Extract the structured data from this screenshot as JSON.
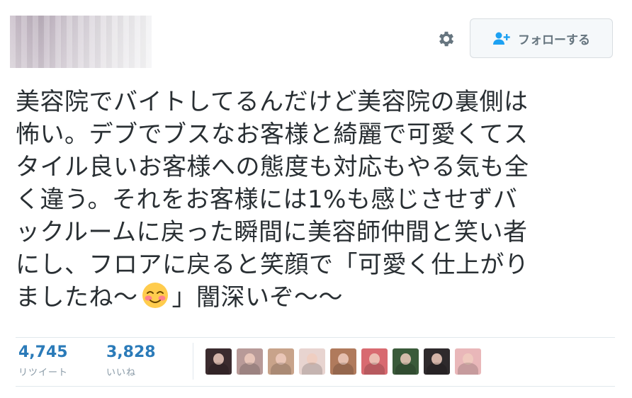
{
  "header": {
    "follow_label": "フォローする"
  },
  "tweet": {
    "lines": [
      "美容院でバイトしてるんだけど美容院の裏側は",
      "怖い。デブでブスなお客様と綺麗で可愛くてス",
      "タイル良いお客様への態度も対応もやる気も全",
      "く違う。それをお客様には1%も感じさせずバ",
      "ックルームに戻った瞬間に美容師仲間と笑い者",
      "にし、フロアに戻ると笑顔で「可愛く仕上がり"
    ],
    "last_line_before_emoji": "ましたね〜",
    "emoji": "smiling-face-with-blush",
    "last_line_after_emoji": "」闇深いぞ〜〜"
  },
  "stats": {
    "retweets": {
      "count": "4,745",
      "label": "リツイート"
    },
    "likes": {
      "count": "3,828",
      "label": "いいね"
    }
  },
  "colors": {
    "link_blue": "#2b7bb9",
    "muted": "#8899a6",
    "follow_icon": "#1da1f2"
  },
  "liker_avatars": [
    {
      "bg": "#3b2b2e"
    },
    {
      "bg": "#b89a98"
    },
    {
      "bg": "#c8a38a"
    },
    {
      "bg": "#e8d4d0"
    },
    {
      "bg": "#b07a5c"
    },
    {
      "bg": "#d86a70"
    },
    {
      "bg": "#3a5a3a"
    },
    {
      "bg": "#2e2a2c"
    },
    {
      "bg": "#e9b7b9"
    }
  ]
}
